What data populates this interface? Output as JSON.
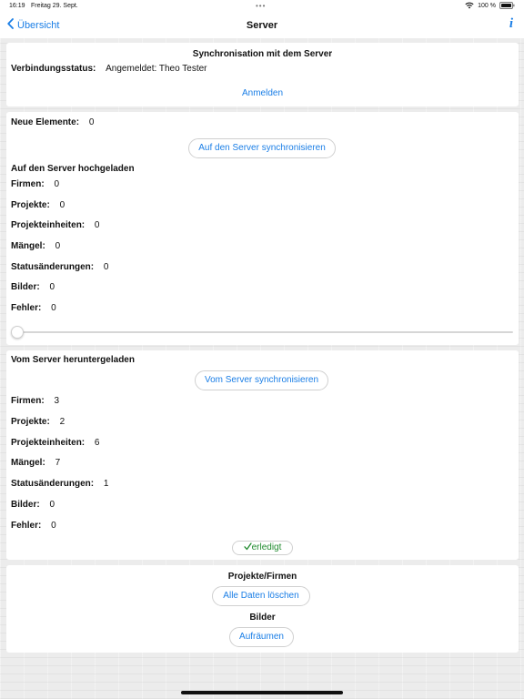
{
  "status_bar": {
    "time": "16:19",
    "date": "Freitag 29. Sept.",
    "dots": "•••",
    "battery": "100 %"
  },
  "nav": {
    "back_label": "Übersicht",
    "title": "Server",
    "info_label": "i"
  },
  "sync_card": {
    "title": "Synchronisation mit dem Server",
    "status_label": "Verbindungsstatus:",
    "status_value": "Angemeldet: Theo Tester",
    "login_label": "Anmelden"
  },
  "upload_card": {
    "new_items_label": "Neue Elemente:",
    "new_items_value": "0",
    "sync_button": "Auf den Server synchronisieren",
    "heading": "Auf den Server hochgeladen",
    "rows": [
      {
        "label": "Firmen:",
        "value": "0"
      },
      {
        "label": "Projekte:",
        "value": "0"
      },
      {
        "label": "Projekteinheiten:",
        "value": "0"
      },
      {
        "label": "Mängel:",
        "value": "0"
      },
      {
        "label": "Statusänderungen:",
        "value": "0"
      },
      {
        "label": "Bilder:",
        "value": "0"
      },
      {
        "label": "Fehler:",
        "value": "0"
      }
    ],
    "progress": 0
  },
  "download_card": {
    "heading": "Vom Server heruntergeladen",
    "sync_button": "Vom Server synchronisieren",
    "rows": [
      {
        "label": "Firmen:",
        "value": "3"
      },
      {
        "label": "Projekte:",
        "value": "2"
      },
      {
        "label": "Projekteinheiten:",
        "value": "6"
      },
      {
        "label": "Mängel:",
        "value": "7"
      },
      {
        "label": "Statusänderungen:",
        "value": "1"
      },
      {
        "label": "Bilder:",
        "value": "0"
      },
      {
        "label": "Fehler:",
        "value": "0"
      }
    ],
    "done_label": "erledigt"
  },
  "maintenance_card": {
    "projects_heading": "Projekte/Firmen",
    "delete_button": "Alle Daten löschen",
    "images_heading": "Bilder",
    "cleanup_button": "Aufräumen"
  },
  "colors": {
    "accent": "#1a7ee6",
    "done": "#1f8a2d"
  }
}
